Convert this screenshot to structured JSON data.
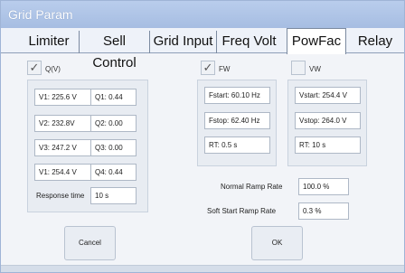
{
  "window": {
    "title": "Grid Param"
  },
  "tabs": [
    {
      "label": "Limiter"
    },
    {
      "label": "Sell Control"
    },
    {
      "label": "Grid Input"
    },
    {
      "label": "Freq Volt"
    },
    {
      "label": "PowFac"
    },
    {
      "label": "Relay"
    }
  ],
  "active_tab": "PowFac",
  "qv": {
    "label": "Q(V)",
    "checked": true,
    "check_glyph": "✓",
    "rows": [
      {
        "v": "V1: 225.6 V",
        "q": "Q1: 0.44"
      },
      {
        "v": "V2: 232.8V",
        "q": "Q2: 0.00"
      },
      {
        "v": "V3: 247.2 V",
        "q": "Q3: 0.00"
      },
      {
        "v": "V1: 254.4 V",
        "q": "Q4: 0.44"
      }
    ],
    "response_label": "Response time",
    "response_value": "10 s"
  },
  "fw": {
    "label": "FW",
    "checked": true,
    "check_glyph": "✓",
    "fstart": "Fstart: 60.10 Hz",
    "fstop": "Fstop: 62.40 Hz",
    "rt": "RT: 0.5 s"
  },
  "vw": {
    "label": "VW",
    "checked": false,
    "vstart": "Vstart: 254.4 V",
    "vstop": "Vstop: 264.0 V",
    "rt": "RT: 10 s"
  },
  "ramp": {
    "normal_label": "Normal Ramp Rate",
    "normal_value": "100.0 %",
    "soft_label": "Soft Start Ramp Rate",
    "soft_value": "0.3 %"
  },
  "buttons": {
    "cancel": "Cancel",
    "ok": "OK"
  },
  "colors": {
    "titlebar": "#a6bde2",
    "panel": "#e8ecf2",
    "border": "#c9d2de"
  }
}
